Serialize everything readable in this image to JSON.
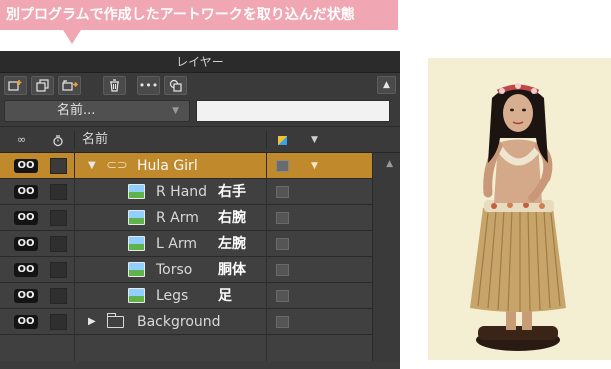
{
  "caption": "別プログラムで作成したアートワークを取り込んだ状態",
  "panel": {
    "title": "レイヤー",
    "toolbar_icons": [
      "new-layer-icon",
      "duplicate-icon",
      "new-group-icon",
      "trash-icon",
      "more-icon",
      "copy-icon"
    ],
    "more_label": "•••",
    "trash_label": "🗑",
    "collapse_icon": "▲",
    "name_select": "名前...",
    "search_placeholder": "",
    "columns": {
      "visibility_icon": "∞",
      "lock_icon": "ð",
      "name": "名前"
    }
  },
  "layers": [
    {
      "name": "Hula Girl",
      "annotation": "",
      "type": "group",
      "expanded": true,
      "selected": true
    },
    {
      "name": "R Hand",
      "annotation": "右手",
      "type": "image",
      "selected": false
    },
    {
      "name": "R Arm",
      "annotation": "右腕",
      "type": "image",
      "selected": false
    },
    {
      "name": "L Arm",
      "annotation": "左腕",
      "type": "image",
      "selected": false
    },
    {
      "name": "Torso",
      "annotation": "胴体",
      "type": "image",
      "selected": false
    },
    {
      "name": "Legs",
      "annotation": "足",
      "type": "image",
      "selected": false
    },
    {
      "name": "Background",
      "annotation": "",
      "type": "folder",
      "expanded": false,
      "selected": false
    }
  ],
  "colors": {
    "callout": "#f0a7b3",
    "selected_row": "#c08a2c",
    "panel_bg": "#3c3c3c"
  }
}
